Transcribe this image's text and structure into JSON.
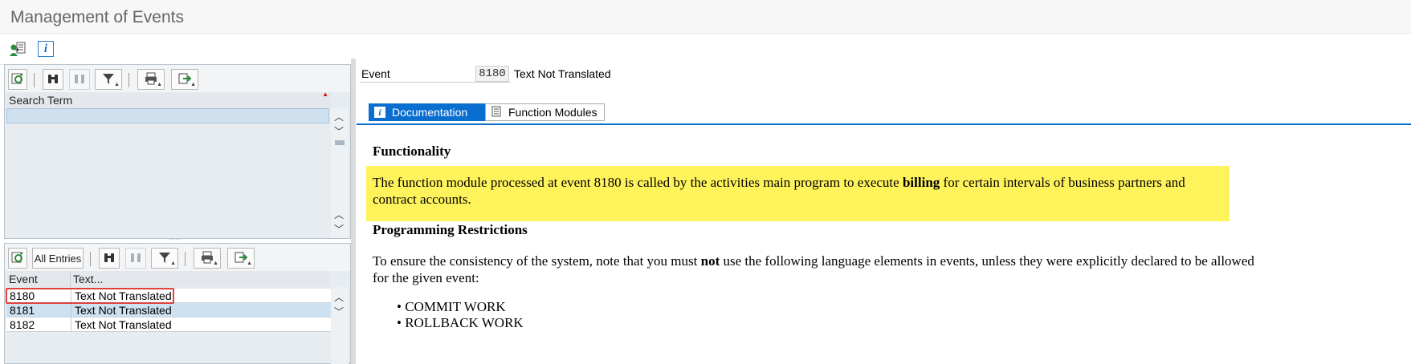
{
  "window": {
    "title": "Management of Events"
  },
  "app_toolbar": {
    "icons": [
      "user-assignment-icon",
      "info-icon"
    ],
    "info_glyph": "i"
  },
  "search_panel": {
    "column_header": "Search Term",
    "search_value": ""
  },
  "events_panel": {
    "all_entries_label": "All Entries",
    "columns": [
      "Event",
      "Text..."
    ],
    "rows": [
      {
        "event": "8180",
        "text": "Text Not Translated"
      },
      {
        "event": "8181",
        "text": "Text Not Translated"
      },
      {
        "event": "8182",
        "text": "Text Not Translated"
      }
    ]
  },
  "detail": {
    "event_label": "Event",
    "event_value": "8180",
    "event_text": "Text Not Translated",
    "tabs": [
      {
        "label": "Documentation",
        "active": true
      },
      {
        "label": "Function Modules",
        "active": false
      }
    ],
    "doc": {
      "heading1": "Functionality",
      "para1_a": "The function module processed at event 8180 is called by the activities main program to execute ",
      "para1_bold": "billing",
      "para1_b": " for certain intervals of business partners and contract accounts.",
      "heading2": "Programming Restrictions",
      "para2_a": "To ensure the consistency of the system, note that you must ",
      "para2_bold": "not",
      "para2_b": " use the following language elements in events, unless they were explicitly declared to be allowed for the given event:",
      "bullets": [
        "COMMIT WORK",
        "ROLLBACK WORK"
      ]
    }
  },
  "colors": {
    "accent_blue": "#0a6ed1",
    "highlight_yellow": "#fff35c",
    "selected_row": "#cde1f1",
    "red_outline": "#e0403a"
  }
}
